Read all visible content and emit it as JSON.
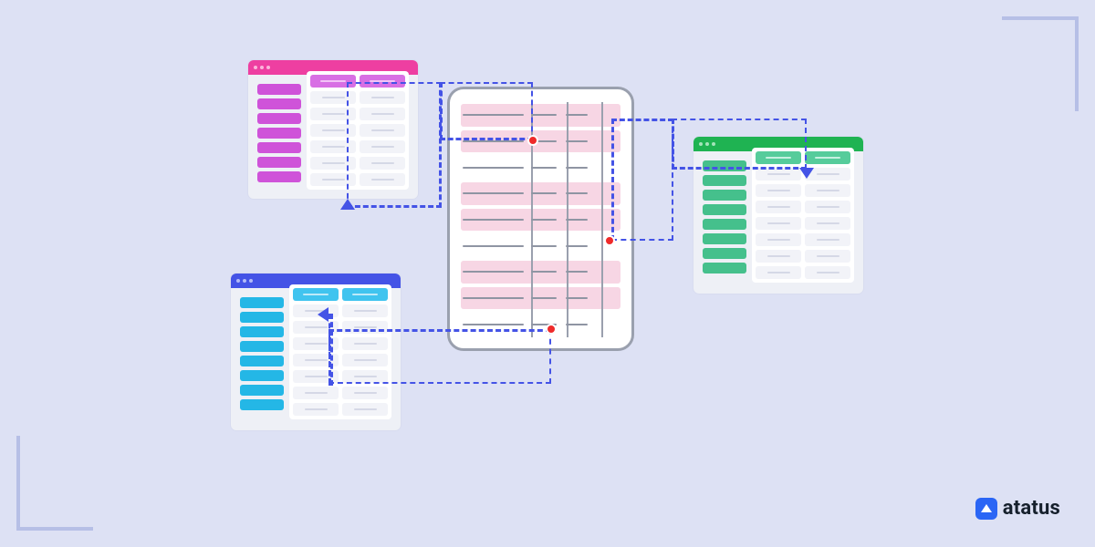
{
  "brand": {
    "name": "atatus"
  },
  "colors": {
    "background": "#dde1f4",
    "corner_bracket": "#b6bfe6",
    "connector": "#4453e6",
    "hotspot": "#ef2a2a",
    "doc_border": "#9aa0ae",
    "doc_band": "#f7d6e4",
    "themes": {
      "pink": {
        "titlebar": "#ee3fa1",
        "accent": "#cf53d9",
        "header": "#d86fe4"
      },
      "blue": {
        "titlebar": "#4453e6",
        "accent": "#24b7e6",
        "header": "#40c4ef"
      },
      "green": {
        "titlebar": "#1fb352",
        "accent": "#45c08c",
        "header": "#56cc9b"
      }
    },
    "brand": "#2a65f5"
  },
  "diagram": {
    "concept": "central-source-to-dashboards",
    "central_document": {
      "rows": 9,
      "columns": 4,
      "highlighted_band_rows": [
        0,
        1,
        3,
        4,
        6,
        7
      ],
      "hotspots": [
        {
          "id": "hotspot-top",
          "approx_col": 2,
          "approx_row": 1
        },
        {
          "id": "hotspot-middle",
          "approx_col": 3,
          "approx_row": 5
        },
        {
          "id": "hotspot-bottom",
          "approx_col": 2,
          "approx_row": 8
        }
      ]
    },
    "dashboards": [
      {
        "id": "dashboard-pink",
        "theme": "pink",
        "position": "top-left"
      },
      {
        "id": "dashboard-blue",
        "theme": "blue",
        "position": "bottom-left"
      },
      {
        "id": "dashboard-green",
        "theme": "green",
        "position": "right"
      }
    ],
    "connectors": [
      {
        "from": "hotspot-top",
        "to": "dashboard-pink",
        "arrow": "up"
      },
      {
        "from": "hotspot-bottom",
        "to": "dashboard-blue",
        "arrow": "left"
      },
      {
        "from": "hotspot-middle",
        "to": "dashboard-green",
        "arrow": "down"
      }
    ]
  }
}
